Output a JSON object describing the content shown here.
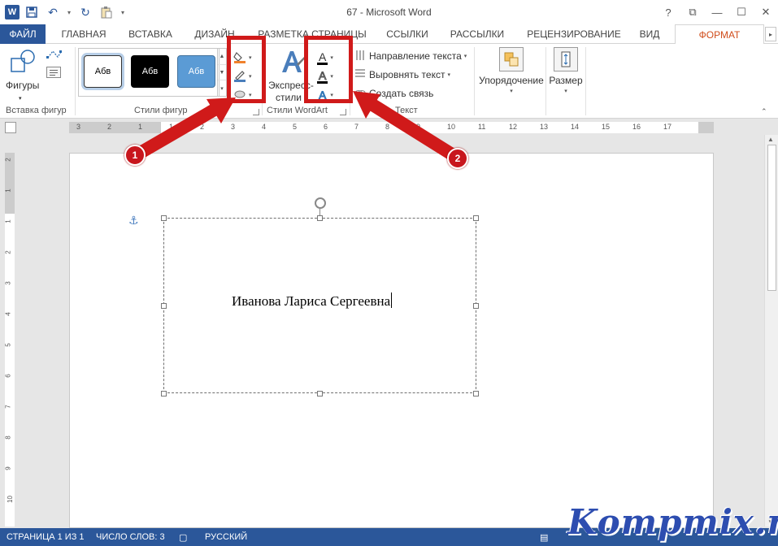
{
  "window": {
    "title": "67 - Microsoft Word",
    "logo_letter": "W",
    "help": "?",
    "ribbon_options": "⧉",
    "minimize": "—",
    "maximize": "☐",
    "close": "✕"
  },
  "tabs": {
    "file": "ФАЙЛ",
    "home": "ГЛАВНАЯ",
    "insert": "ВСТАВКА",
    "design": "ДИЗАЙН",
    "layout": "РАЗМЕТКА СТРАНИЦЫ",
    "references": "ССЫЛКИ",
    "mailings": "РАССЫЛКИ",
    "review": "РЕЦЕНЗИРОВАНИЕ",
    "view": "ВИД",
    "format": "ФОРМАТ"
  },
  "ribbon": {
    "insert_shapes": {
      "shapes_label": "Фигуры",
      "group_label": "Вставка фигур"
    },
    "shape_styles": {
      "previews": [
        "Абв",
        "Абв",
        "Абв"
      ],
      "group_label": "Стили фигур"
    },
    "wordart": {
      "express_label_1": "Экспресс-",
      "express_label_2": "стили",
      "group_label": "Стили WordArt"
    },
    "text": {
      "direction": "Направление текста",
      "align": "Выровнять текст",
      "link": "Создать связь",
      "group_label": "Текст"
    },
    "arrange": {
      "label": "Упорядочение"
    },
    "size": {
      "label": "Размер"
    }
  },
  "ruler": {
    "h_ticks": [
      "3",
      "2",
      "1",
      "1",
      "2",
      "3",
      "4",
      "5",
      "6",
      "7",
      "8",
      "9",
      "10",
      "11",
      "12",
      "13",
      "14",
      "15",
      "16",
      "17"
    ],
    "v_ticks": [
      "2",
      "1",
      "1",
      "2",
      "3",
      "4",
      "5",
      "6",
      "7",
      "8",
      "9",
      "10"
    ]
  },
  "document": {
    "textbox_text": "Иванова Лариса Сергеевна"
  },
  "status": {
    "page": "СТРАНИЦА 1 ИЗ 1",
    "words": "ЧИСЛО СЛОВ: 3",
    "language": "РУССКИЙ"
  },
  "annotations": {
    "marker_1": "1",
    "marker_2": "2",
    "color": "#d01a1a"
  },
  "watermark": "Kompmix.ru",
  "colors": {
    "word_blue": "#2b579a",
    "format_tab": "#d04c1a"
  }
}
